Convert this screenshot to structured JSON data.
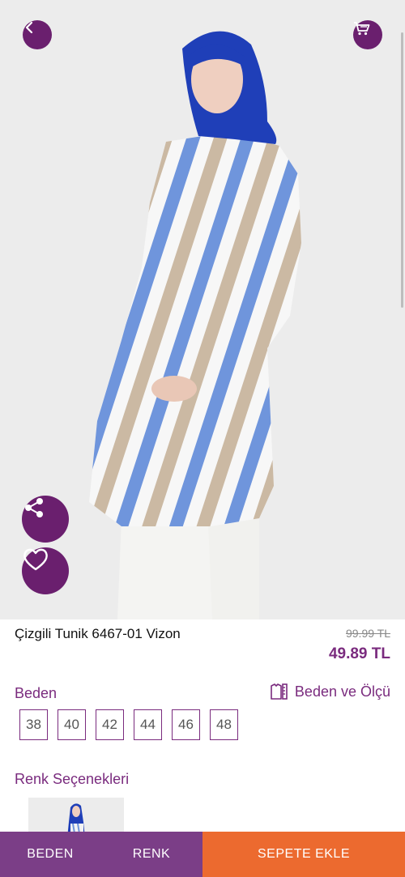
{
  "product": {
    "title": "Çizgili Tunik 6467-01 Vizon",
    "old_price": "99.99 TL",
    "new_price": "49.89 TL"
  },
  "sizes": {
    "label": "Beden",
    "guide_label": "Beden ve Ölçü",
    "options": [
      "38",
      "40",
      "42",
      "44",
      "46",
      "48"
    ]
  },
  "colors": {
    "label": "Renk Seçenekleri"
  },
  "bottom_bar": {
    "size_tab": "BEDEN",
    "color_tab": "RENK",
    "add_to_cart": "SEPETE EKLE"
  },
  "theme": {
    "primary": "#7a2b7e",
    "button": "#6a1f6e",
    "accent": "#ec6a2f"
  },
  "icons": [
    "chevron-left-icon",
    "cart-icon",
    "share-icon",
    "heart-icon",
    "ruler-icon"
  ]
}
